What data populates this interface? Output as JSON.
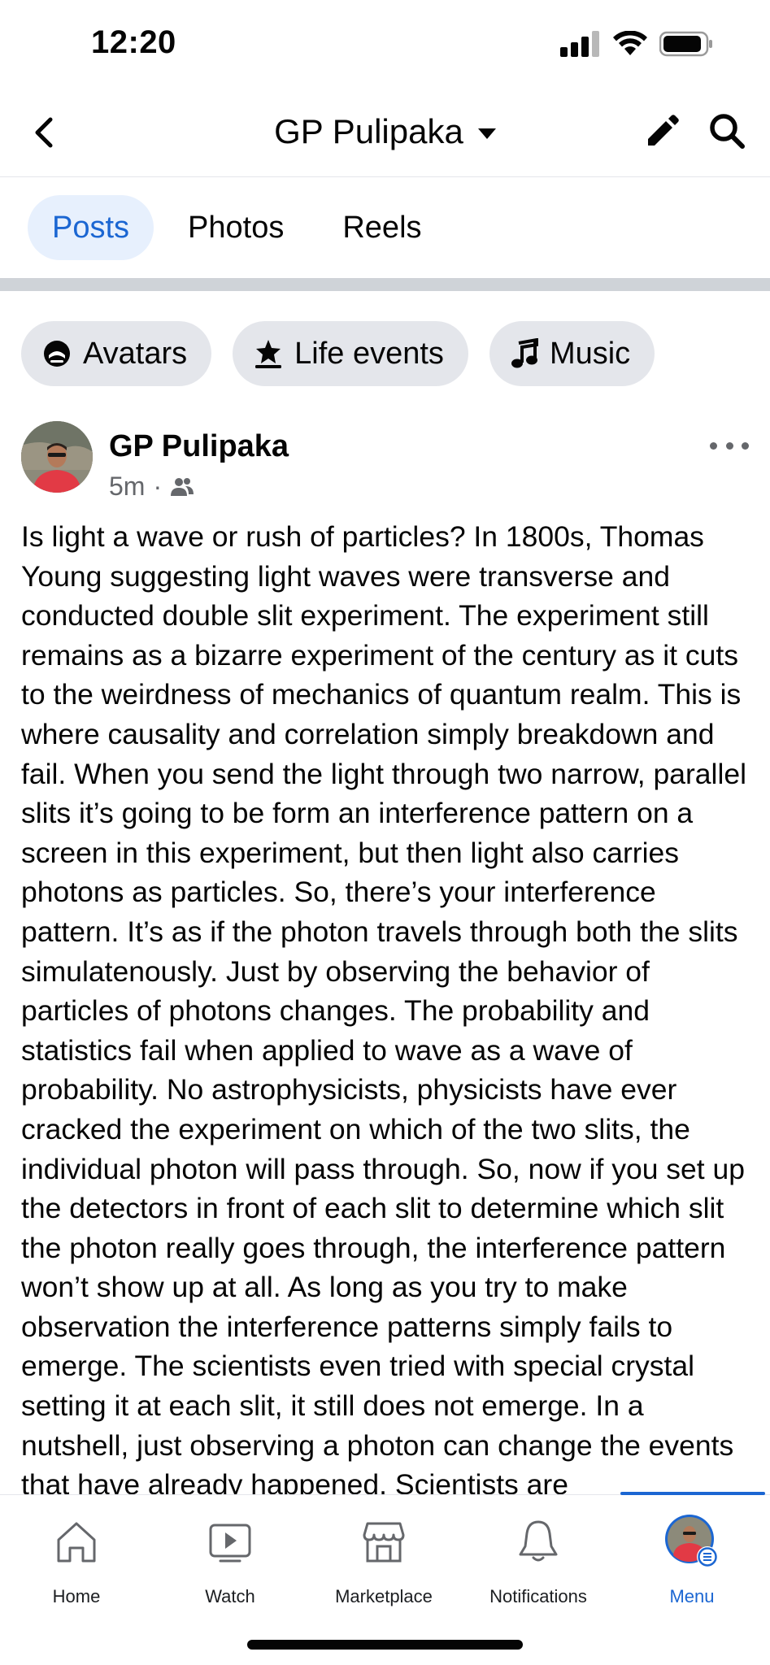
{
  "status_bar": {
    "time": "12:20"
  },
  "header": {
    "title": "GP Pulipaka"
  },
  "tabs": [
    {
      "label": "Posts",
      "active": true
    },
    {
      "label": "Photos",
      "active": false
    },
    {
      "label": "Reels",
      "active": false
    }
  ],
  "chips": [
    {
      "label": "Avatars",
      "icon": "avatar-icon"
    },
    {
      "label": "Life events",
      "icon": "star-flag-icon"
    },
    {
      "label": "Music",
      "icon": "music-note-icon"
    }
  ],
  "post": {
    "author": "GP Pulipaka",
    "time": "5m",
    "separator": "·",
    "audience_icon": "friends-icon",
    "text": "Is light a wave or rush of particles? In 1800s, Thomas Young suggesting light waves were transverse and conducted double slit experiment. The experiment still remains as a bizarre experiment of the century as it cuts to the weirdness of mechanics of quantum realm. This is where causality and correlation simply breakdown and fail. When you send the light through two narrow, parallel slits it’s going to be form an interference pattern on a screen in this experiment, but then light also carries photons as particles. So, there’s your interference pattern. It’s as if the photon travels through both the slits simulatenously. Just by observing the behavior of particles of photons changes. The probability and statistics fail when applied to wave as a wave of probability. No astrophysicists, physicists have ever cracked the experiment on which of the two slits, the individual photon will pass through. So, now if you set up the detectors in front of each slit to determine which slit the photon really goes through, the interference pattern won’t show up at all. As long as you try to make observation the interference patterns simply fails to emerge. The scientists even tried with special crystal setting it at each slit, it still does not emerge. In a nutshell, just observing a photon can change the events that have already happened. Scientists are"
  },
  "bottom_nav": [
    {
      "label": "Home",
      "icon": "home-icon",
      "active": false
    },
    {
      "label": "Watch",
      "icon": "watch-icon",
      "active": false
    },
    {
      "label": "Marketplace",
      "icon": "marketplace-icon",
      "active": false
    },
    {
      "label": "Notifications",
      "icon": "bell-icon",
      "active": false
    },
    {
      "label": "Menu",
      "icon": "profile-menu-icon",
      "active": true
    }
  ],
  "colors": {
    "accent": "#1b66d2",
    "active_tab_bg": "#e7f0fd",
    "chip_bg": "#e4e6eb",
    "secondary_text": "#65676b"
  }
}
